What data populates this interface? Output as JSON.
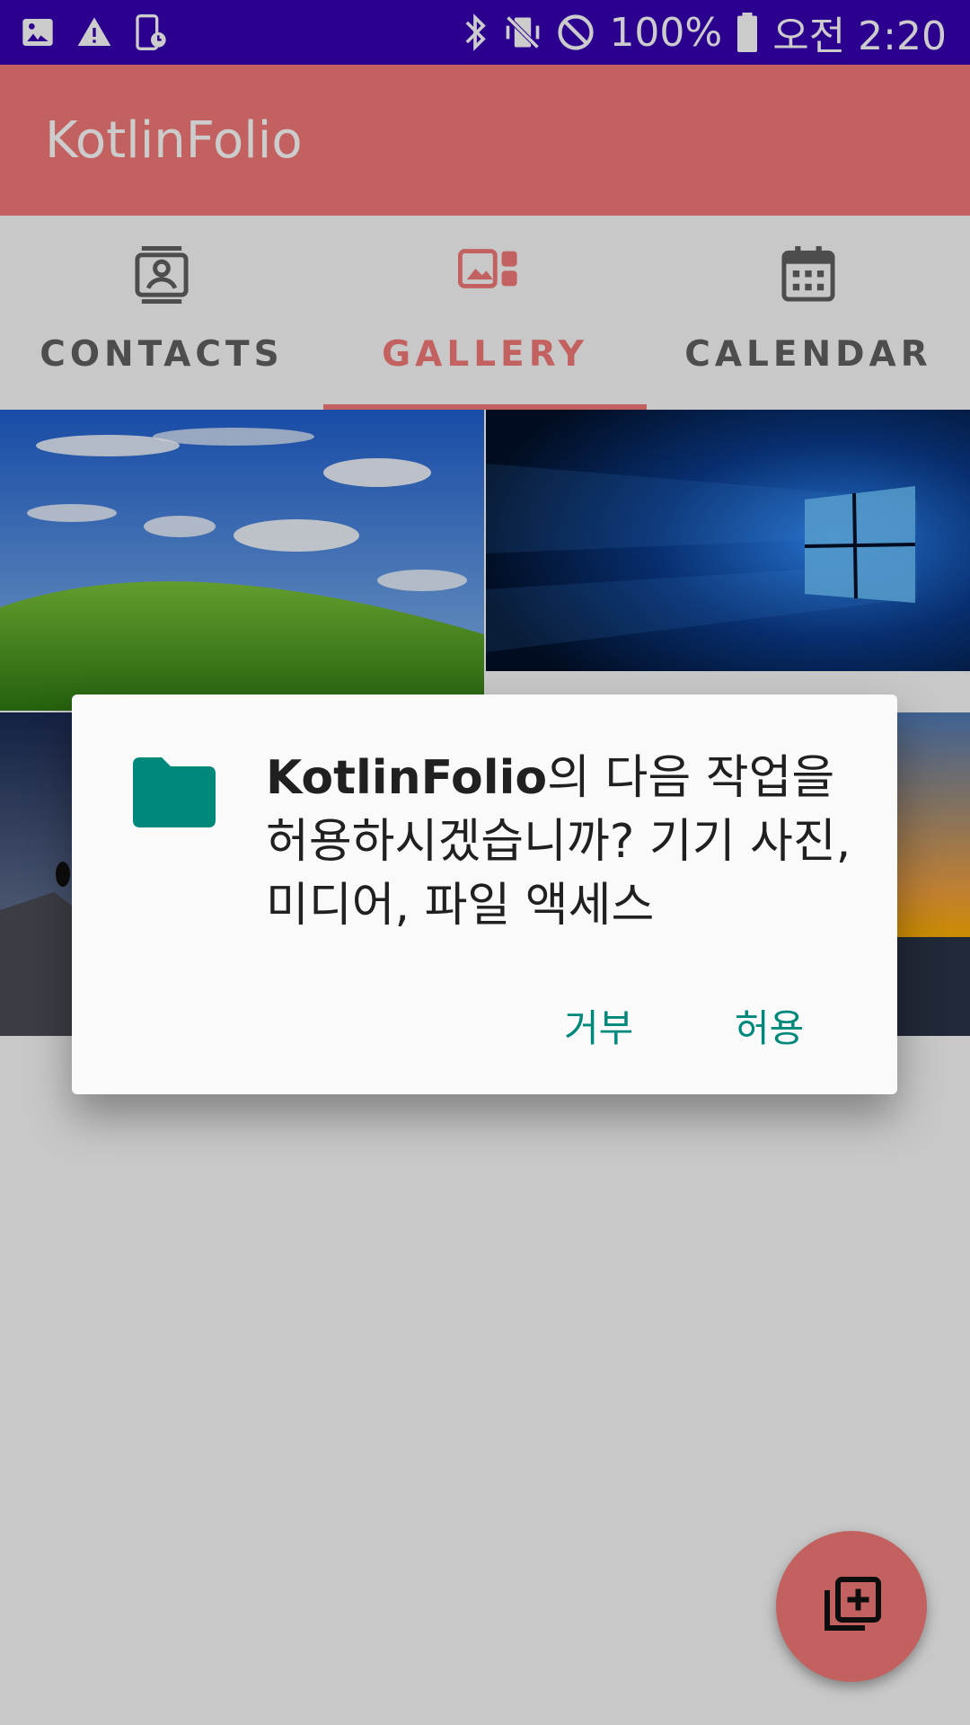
{
  "status_bar": {
    "battery": "100%",
    "time": "오전 2:20",
    "left_icons": [
      "image-icon",
      "warning-icon",
      "screen-record-icon"
    ],
    "right_icons": [
      "bluetooth-icon",
      "vibrate-off-icon",
      "do-not-disturb-icon",
      "battery-icon"
    ]
  },
  "app_bar": {
    "title": "KotlinFolio",
    "color": "#f47a7a"
  },
  "tabs": [
    {
      "label": "CONTACTS",
      "icon": "contacts-icon",
      "active": false
    },
    {
      "label": "GALLERY",
      "icon": "gallery-icon",
      "active": true
    },
    {
      "label": "CALENDAR",
      "icon": "calendar-icon",
      "active": false
    }
  ],
  "gallery": {
    "photos": [
      "grassy-hill-blue-sky",
      "blue-window-light",
      "rocky-shore-sunset",
      "sea-sunset"
    ]
  },
  "dialog": {
    "app_name": "KotlinFolio",
    "message": "의 다음 작업을 허용하시겠습니까? 기기 사진, 미디어, 파일 액세스",
    "icon": "folder-icon",
    "deny_label": "거부",
    "allow_label": "허용",
    "accent_color": "#00897b"
  },
  "fab": {
    "icon": "add-to-collection-icon"
  }
}
